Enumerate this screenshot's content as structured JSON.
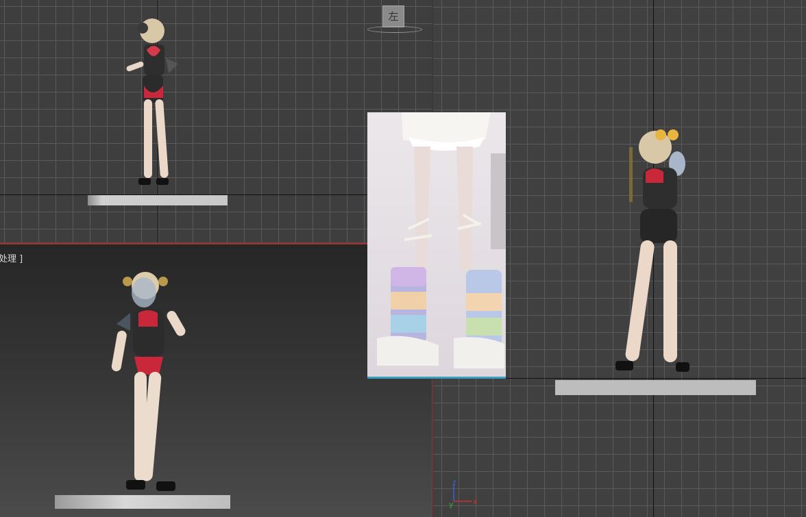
{
  "viewports": {
    "bottom_left_label": "处理 ]",
    "top_left_viewcube_glyph": "左"
  },
  "axis_gizmo": {
    "x": "x",
    "y": "y",
    "z": "z"
  },
  "colors": {
    "grid_line": "#5a5a5a",
    "grid_bg": "#3e3e3e",
    "active_border": "#8e3a3a",
    "reference_accent": "#3aa0c0"
  }
}
